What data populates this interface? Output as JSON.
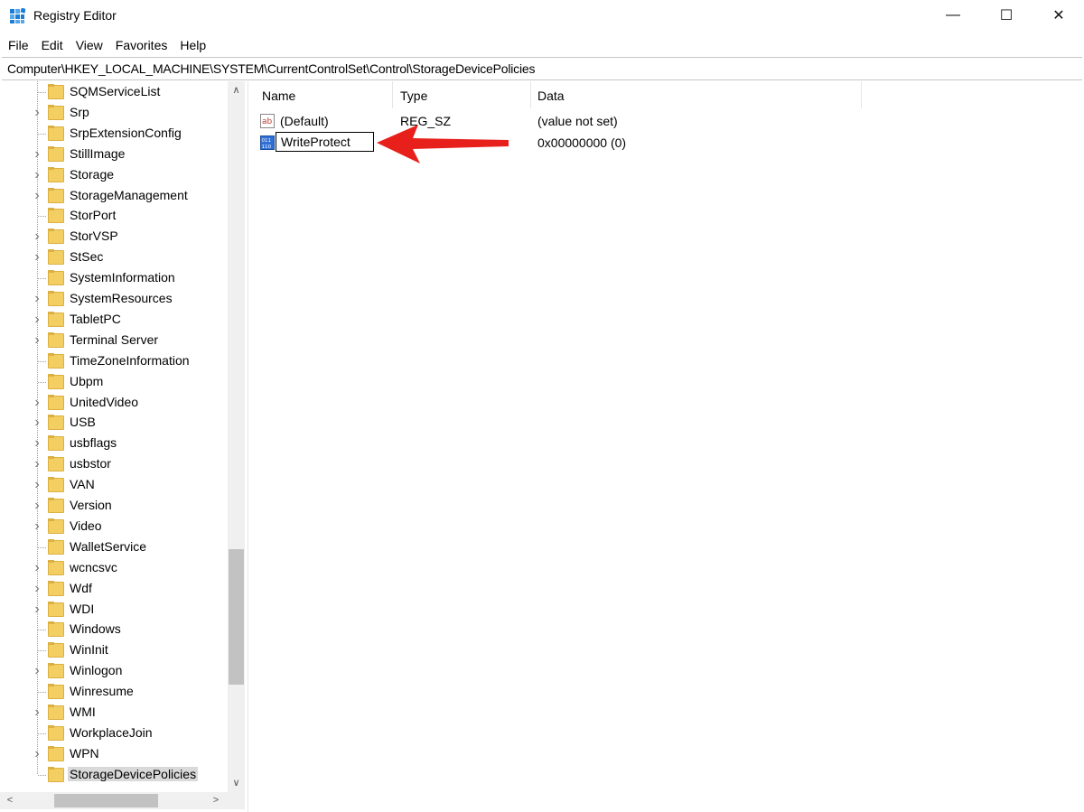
{
  "window": {
    "title": "Registry Editor",
    "icon": "registry-editor-icon",
    "controls": {
      "minimize": "—",
      "maximize": "☐",
      "close": "✕"
    }
  },
  "menu": [
    "File",
    "Edit",
    "View",
    "Favorites",
    "Help"
  ],
  "address": "Computer\\HKEY_LOCAL_MACHINE\\SYSTEM\\CurrentControlSet\\Control\\StorageDevicePolicies",
  "tree": {
    "items": [
      {
        "label": "SQMServiceList",
        "expandable": false
      },
      {
        "label": "Srp",
        "expandable": true
      },
      {
        "label": "SrpExtensionConfig",
        "expandable": false
      },
      {
        "label": "StillImage",
        "expandable": true
      },
      {
        "label": "Storage",
        "expandable": true
      },
      {
        "label": "StorageManagement",
        "expandable": true
      },
      {
        "label": "StorPort",
        "expandable": false
      },
      {
        "label": "StorVSP",
        "expandable": true
      },
      {
        "label": "StSec",
        "expandable": true
      },
      {
        "label": "SystemInformation",
        "expandable": false
      },
      {
        "label": "SystemResources",
        "expandable": true
      },
      {
        "label": "TabletPC",
        "expandable": true
      },
      {
        "label": "Terminal Server",
        "expandable": true
      },
      {
        "label": "TimeZoneInformation",
        "expandable": false
      },
      {
        "label": "Ubpm",
        "expandable": false
      },
      {
        "label": "UnitedVideo",
        "expandable": true
      },
      {
        "label": "USB",
        "expandable": true
      },
      {
        "label": "usbflags",
        "expandable": true
      },
      {
        "label": "usbstor",
        "expandable": true
      },
      {
        "label": "VAN",
        "expandable": true
      },
      {
        "label": "Version",
        "expandable": true
      },
      {
        "label": "Video",
        "expandable": true
      },
      {
        "label": "WalletService",
        "expandable": false
      },
      {
        "label": "wcncsvc",
        "expandable": true
      },
      {
        "label": "Wdf",
        "expandable": true
      },
      {
        "label": "WDI",
        "expandable": true
      },
      {
        "label": "Windows",
        "expandable": false
      },
      {
        "label": "WinInit",
        "expandable": false
      },
      {
        "label": "Winlogon",
        "expandable": true
      },
      {
        "label": "Winresume",
        "expandable": false
      },
      {
        "label": "WMI",
        "expandable": true
      },
      {
        "label": "WorkplaceJoin",
        "expandable": false
      },
      {
        "label": "WPN",
        "expandable": true
      },
      {
        "label": "StorageDevicePolicies",
        "expandable": false,
        "selected": true
      }
    ]
  },
  "columns": {
    "name": "Name",
    "type": "Type",
    "data": "Data"
  },
  "values": [
    {
      "name": "(Default)",
      "type": "REG_SZ",
      "data": "(value not set)",
      "icon": "string-value-icon"
    },
    {
      "name": "WriteProtect",
      "type": "",
      "data": "0x00000000 (0)",
      "icon": "dword-value-icon",
      "editing": true
    }
  ],
  "annotation": {
    "type": "arrow",
    "color": "#e8201c"
  },
  "colors": {
    "folder": "#f3cf63",
    "selection": "#d9d9d9",
    "scrollbar_thumb": "#c2c2c2"
  }
}
